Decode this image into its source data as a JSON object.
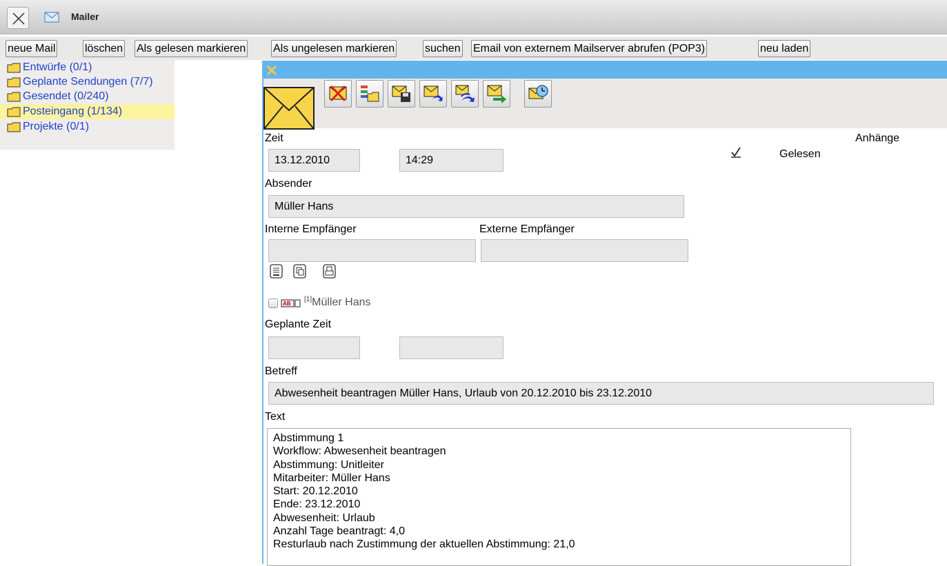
{
  "window": {
    "title": "Mailer",
    "close_icon": "close-x-icon",
    "app_icon": "envelope-icon"
  },
  "toolbar": {
    "buttons": [
      "neue Mail",
      "löschen",
      "Als gelesen markieren",
      "Als ungelesen markieren",
      "suchen",
      "Email von externem Mailserver abrufen (POP3)",
      "neu laden"
    ]
  },
  "folders": [
    {
      "label": "Entwürfe (0/1)",
      "selected": false
    },
    {
      "label": "Geplante Sendungen (7/7)",
      "selected": false
    },
    {
      "label": "Gesendet (0/240)",
      "selected": false
    },
    {
      "label": "Posteingang (1/134)",
      "selected": true
    },
    {
      "label": "Projekte (0/1)",
      "selected": false
    }
  ],
  "mail": {
    "zeit_label": "Zeit",
    "date": "13.12.2010",
    "time": "14:29",
    "anhaenge_label": "Anhänge",
    "gelesen_label": "Gelesen",
    "gelesen_checked": true,
    "absender_label": "Absender",
    "absender": "Müller Hans",
    "interne_label": "Interne Empfänger",
    "externe_label": "Externe Empfänger",
    "interne": "",
    "externe": "",
    "recipient_index": "[1]",
    "recipient_name": "Müller Hans",
    "geplante_label": "Geplante Zeit",
    "geplante_date": "",
    "geplante_time": "",
    "betreff_label": "Betreff",
    "betreff": "Abwesenheit beantragen Müller Hans, Urlaub von 20.12.2010 bis 23.12.2010",
    "text_label": "Text",
    "body_lines": [
      "Abstimmung 1",
      "Workflow: Abwesenheit beantragen",
      "Abstimmung: Unitleiter",
      "Mitarbeiter: Müller Hans",
      "Start: 20.12.2010",
      "Ende: 23.12.2010",
      "Abwesenheit: Urlaub",
      "Anzahl Tage beantragt: 4,0",
      "Resturlaub nach Zustimmung der aktuellen Abstimmung: 21,0"
    ]
  },
  "colors": {
    "folder_link": "#1d43c9",
    "selected_folder": "#fdf39f",
    "panel_header": "#63b4ec"
  }
}
